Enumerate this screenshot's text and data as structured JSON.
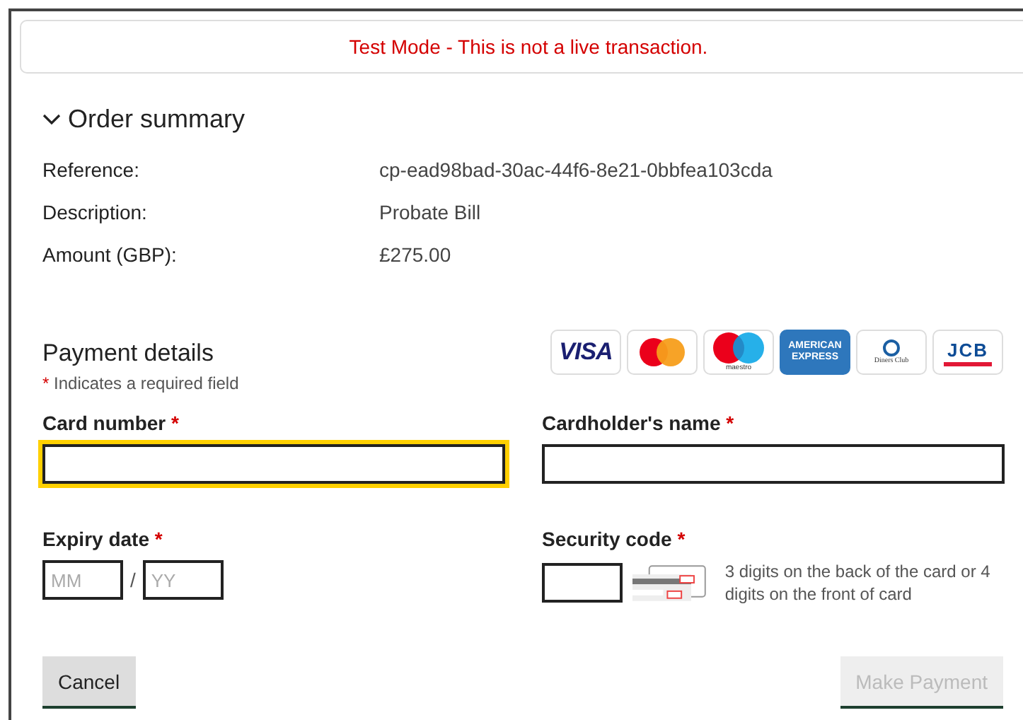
{
  "banner": {
    "message": "Test Mode - This is not a live transaction."
  },
  "order_summary": {
    "title": "Order summary",
    "expanded": true,
    "rows": [
      {
        "label": "Reference:",
        "value": "cp-ead98bad-30ac-44f6-8e21-0bbfea103cda"
      },
      {
        "label": "Description:",
        "value": "Probate Bill"
      },
      {
        "label": "Amount (GBP):",
        "value": "£275.00"
      }
    ]
  },
  "payment": {
    "title": "Payment details",
    "required_mark": "*",
    "required_note": "Indicates a required field",
    "cards": [
      {
        "kind": "visa",
        "label": "VISA"
      },
      {
        "kind": "mastercard"
      },
      {
        "kind": "maestro",
        "label": "maestro"
      },
      {
        "kind": "amex",
        "label": "AMERICAN EXPRESS"
      },
      {
        "kind": "diners",
        "label": "Diners Club"
      },
      {
        "kind": "jcb",
        "label": "JCB"
      }
    ],
    "card_number": {
      "label": "Card number",
      "required": true,
      "focused": true
    },
    "cardholder_name": {
      "label": "Cardholder's name",
      "required": true,
      "focused": false
    },
    "expiry": {
      "label": "Expiry date",
      "required": true,
      "month_placeholder": "MM",
      "separator": "/",
      "year_placeholder": "YY"
    },
    "security_code": {
      "label": "Security code",
      "required": true,
      "hint": "3 digits on the back of the card or 4 digits on the front of card"
    }
  },
  "buttons": [
    {
      "label": "Cancel",
      "disabled": false
    },
    {
      "label": "Make Payment",
      "disabled": true
    }
  ]
}
